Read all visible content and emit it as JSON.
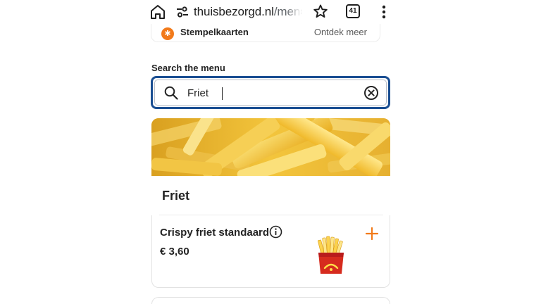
{
  "browser": {
    "url_domain": "thuisbezorgd.nl",
    "url_rest": "/menu",
    "tab_count": "41"
  },
  "loyalty": {
    "label": "Stempelkaarten",
    "link": "Ontdek meer"
  },
  "search": {
    "label": "Search the menu",
    "value": "Friet"
  },
  "category": {
    "title": "Friet"
  },
  "items": [
    {
      "name": "Crispy friet standaard",
      "price": "€ 3,60"
    }
  ],
  "colors": {
    "accent": "#F27A1A",
    "focus_border": "#1A4E92",
    "text": "#242424"
  }
}
